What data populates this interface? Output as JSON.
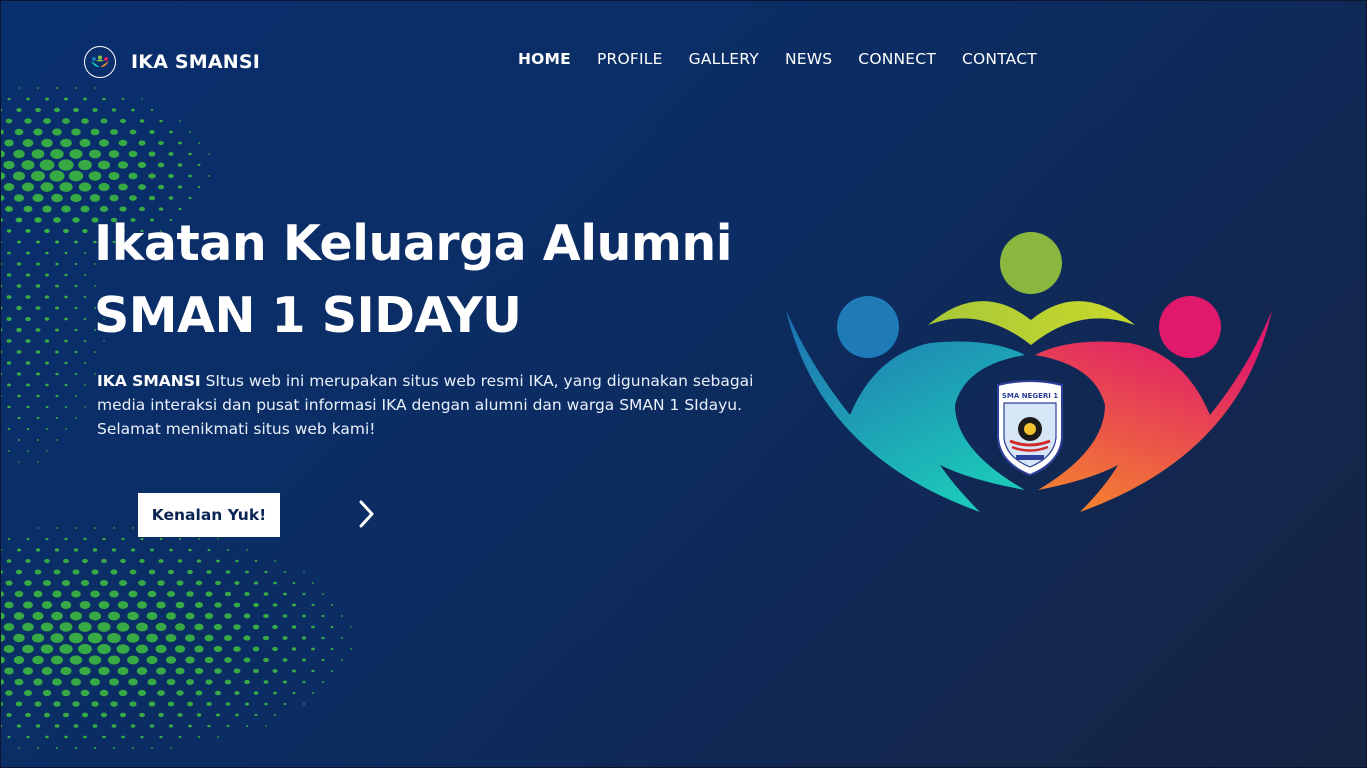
{
  "brand": {
    "name": "IKA SMANSI",
    "logo_icon": "ika-people-logo-icon"
  },
  "nav": {
    "items": [
      {
        "label": "HOME",
        "active": true
      },
      {
        "label": "PROFILE",
        "active": false
      },
      {
        "label": "GALLERY",
        "active": false
      },
      {
        "label": "NEWS",
        "active": false
      },
      {
        "label": "CONNECT",
        "active": false
      },
      {
        "label": "CONTACT",
        "active": false
      }
    ]
  },
  "hero": {
    "title_line1": "Ikatan Keluarga Alumni",
    "title_line2": "SMAN 1 SIDAYU",
    "desc_strong": "IKA SMANSI",
    "desc_text": " SItus web ini merupakan situs web resmi IKA, yang digunakan sebagai media interaksi dan pusat informasi IKA dengan alumni dan warga SMAN 1 SIdayu. Selamat menikmati situs web kami!",
    "cta_label": "Kenalan Yuk!",
    "next_icon": "chevron-right-icon",
    "logo_icon": "ika-smansi-emblem-icon"
  },
  "colors": {
    "bg_top": "#0a2f6e",
    "bg_bottom": "#162443",
    "dot_green": "#3fbf3f",
    "figure_blue": "#1f7ab8",
    "figure_green": "#8cc63f",
    "figure_pink": "#e0196c",
    "figure_teal": "#1cc6b8",
    "figure_orange": "#f58a2a"
  }
}
